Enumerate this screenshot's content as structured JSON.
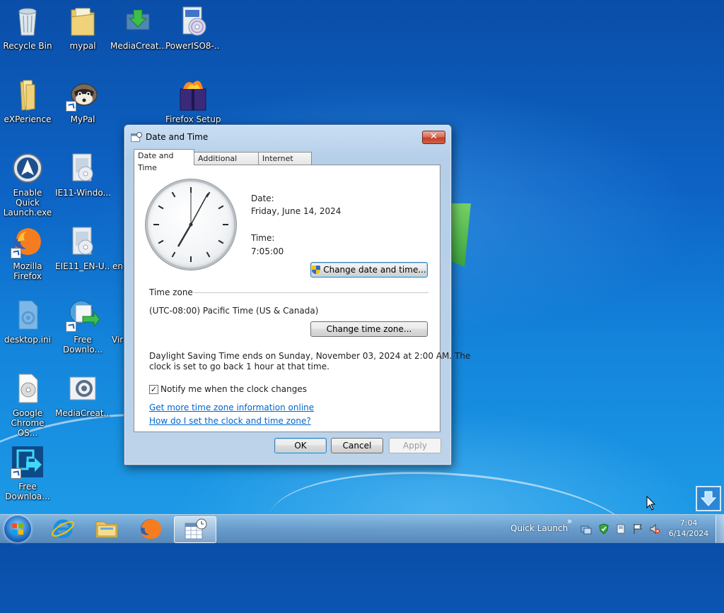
{
  "desktop": {
    "icons": [
      {
        "label": "Recycle Bin",
        "icon": "recycle-bin-icon"
      },
      {
        "label": "mypal",
        "icon": "folder-icon"
      },
      {
        "label": "MediaCreat...",
        "icon": "media-creation-tool-icon"
      },
      {
        "label": "PowerISO8-...",
        "icon": "poweriso-installer-icon"
      },
      {
        "label": "eXPerience",
        "icon": "folder-icon"
      },
      {
        "label": "MyPal",
        "icon": "mypal-raccoon-icon"
      },
      {
        "label": "Firefox Setup",
        "icon": "firefox-setup-icon"
      },
      {
        "label": "Enable Quick Launch.exe",
        "icon": "quick-launch-app-icon"
      },
      {
        "label": "IE11-Windo...",
        "icon": "ie11-installer-icon"
      },
      {
        "label": "Mozilla Firefox",
        "icon": "firefox-icon"
      },
      {
        "label": "EIE11_EN-U...",
        "icon": "ie11-installer-icon"
      },
      {
        "label": "en-",
        "icon": "file-icon"
      },
      {
        "label": "desktop.ini",
        "icon": "settings-file-icon"
      },
      {
        "label": "Free Downlo...",
        "icon": "free-download-manager-icon"
      },
      {
        "label": "Vir",
        "icon": "file-icon"
      },
      {
        "label": "Google Chrome OS...",
        "icon": "disc-image-icon"
      },
      {
        "label": "MediaCreat...",
        "icon": "media-creation-tool-icon"
      },
      {
        "label": "Free Downloa...",
        "icon": "free-download-manager-icon"
      }
    ]
  },
  "dialog": {
    "title": "Date and Time",
    "close_label": "✕",
    "tabs": [
      "Date and Time",
      "Additional Clocks",
      "Internet Time"
    ],
    "date_label": "Date:",
    "date_value": "Friday, June 14, 2024",
    "time_label": "Time:",
    "time_value": "7:05:00",
    "change_datetime_button": "Change date and time...",
    "timezone_heading": "Time zone",
    "timezone_value": "(UTC-08:00) Pacific Time (US & Canada)",
    "change_timezone_button": "Change time zone...",
    "dst_text_line1": "Daylight Saving Time ends on Sunday, November 03, 2024 at 2:00 AM. The",
    "dst_text_line2": "clock is set to go back 1 hour at that time.",
    "notify_label": "Notify me when the clock changes",
    "notify_checked": true,
    "link_more_info": "Get more time zone information online",
    "link_how_set": "How do I set the clock and time zone?",
    "ok_button": "OK",
    "cancel_button": "Cancel",
    "apply_button": "Apply"
  },
  "taskbar": {
    "quick_launch_label": "Quick Launch",
    "chevron": "»",
    "clock_time": "7:04",
    "clock_date": "6/14/2024",
    "pinned": [
      "start-orb-icon",
      "internet-explorer-icon",
      "file-explorer-icon",
      "firefox-icon",
      "date-time-control-panel-icon"
    ]
  },
  "colors": {
    "link": "#0066cc",
    "close_button": "#c2402a",
    "desktop_blue": "#0d63c5"
  }
}
